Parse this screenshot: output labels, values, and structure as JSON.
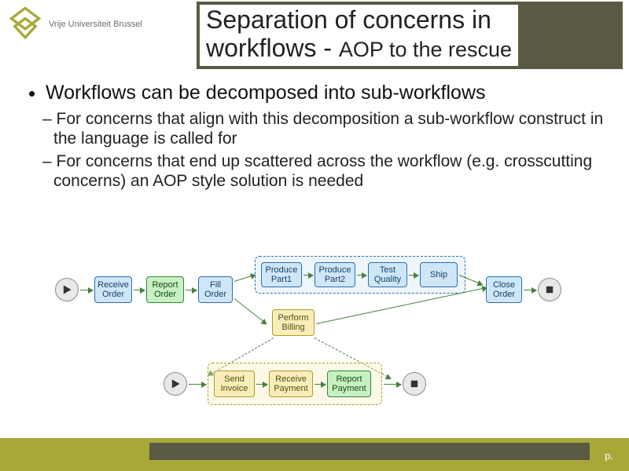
{
  "header": {
    "university": "Vrije Universiteit Brussel",
    "title_l1": "Separation of concerns in",
    "title_l2a": "workflows - ",
    "title_l2b": "AOP to the rescue"
  },
  "bullets": {
    "main": "Workflows can be decomposed into sub-workflows",
    "sub1": "For concerns that align with this decomposition a sub-workflow construct in the language is called for",
    "sub2": "For concerns that end up scattered across the workflow (e.g. crosscutting concerns) an AOP style solution is needed"
  },
  "diagram": {
    "top_flow": {
      "start": "play",
      "n1": "Receive Order",
      "n2": "Report Order",
      "n3": "Fill Order",
      "group_blue": [
        "Produce Part1",
        "Produce Part2",
        "Test Quality",
        "Ship"
      ],
      "n8": "Perform Billing",
      "n9": "Close Order",
      "end": "stop"
    },
    "bottom_flow": {
      "start": "play",
      "group_yellow": [
        "Send Invoice",
        "Receive Payment",
        "Report Payment"
      ],
      "end": "stop"
    }
  },
  "footer": {
    "page_marker": "p."
  }
}
